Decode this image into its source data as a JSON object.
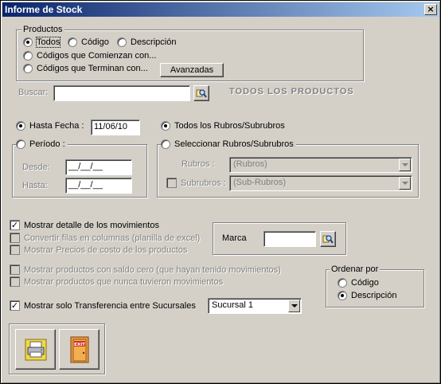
{
  "window": {
    "title": "Informe de Stock",
    "close_glyph": "×"
  },
  "productos": {
    "legend": "Productos",
    "todos": "Todos",
    "codigo": "Código",
    "descripcion": "Descripción",
    "comienzan": "Códigos que Comienzan con...",
    "terminan": "Códigos que Terminan con...",
    "avanzadas": "Avanzadas",
    "selected": "todos"
  },
  "buscar": {
    "label": "Buscar:",
    "value": "",
    "banner": "TODOS LOS PRODUCTOS"
  },
  "fecha": {
    "hasta_fecha_label": "Hasta Fecha :",
    "hasta_fecha_value": "11/06/10",
    "periodo_label": "Período :",
    "desde_label": "Desde:",
    "desde_value": "__/__/__",
    "hasta_label": "Hasta:",
    "hasta_value": "__/__/__",
    "selected": "hasta_fecha"
  },
  "rubros": {
    "todos_label": "Todos los Rubros/Subrubros",
    "seleccionar_label": "Seleccionar Rubros/Subrubros",
    "rubros_label": "Rubros :",
    "rubros_value": "(Rubros)",
    "subrubros_label": "Subrubros :",
    "subrubros_value": "(Sub-Rubros)",
    "selected": "todos"
  },
  "opciones": {
    "mostrar_detalle": "Mostrar detalle de los movimientos",
    "convertir_filas": "Convertir filas en columnas (planilla de excel)",
    "mostrar_precios": "Mostrar Precios de costo de los productos",
    "saldo_cero": "Mostrar productos con saldo cero (que hayan tenido movimientos)",
    "nunca_movimientos": "Mostrar productos que nunca tuvieron movimientos",
    "transferencia": "Mostrar solo Transferencia entre Sucursales",
    "sucursal_value": "Sucursal 1"
  },
  "marca": {
    "label": "Marca",
    "value": ""
  },
  "ordenar": {
    "legend": "Ordenar por",
    "codigo": "Código",
    "descripcion": "Descripción",
    "selected": "descripcion"
  },
  "actions": {
    "print_icon": "printer-icon",
    "exit_icon": "exit-door-icon",
    "exit_text": "EXIT"
  },
  "colors": {
    "title_start": "#0a246a",
    "title_end": "#a6caf0",
    "face": "#d4d0c8"
  }
}
